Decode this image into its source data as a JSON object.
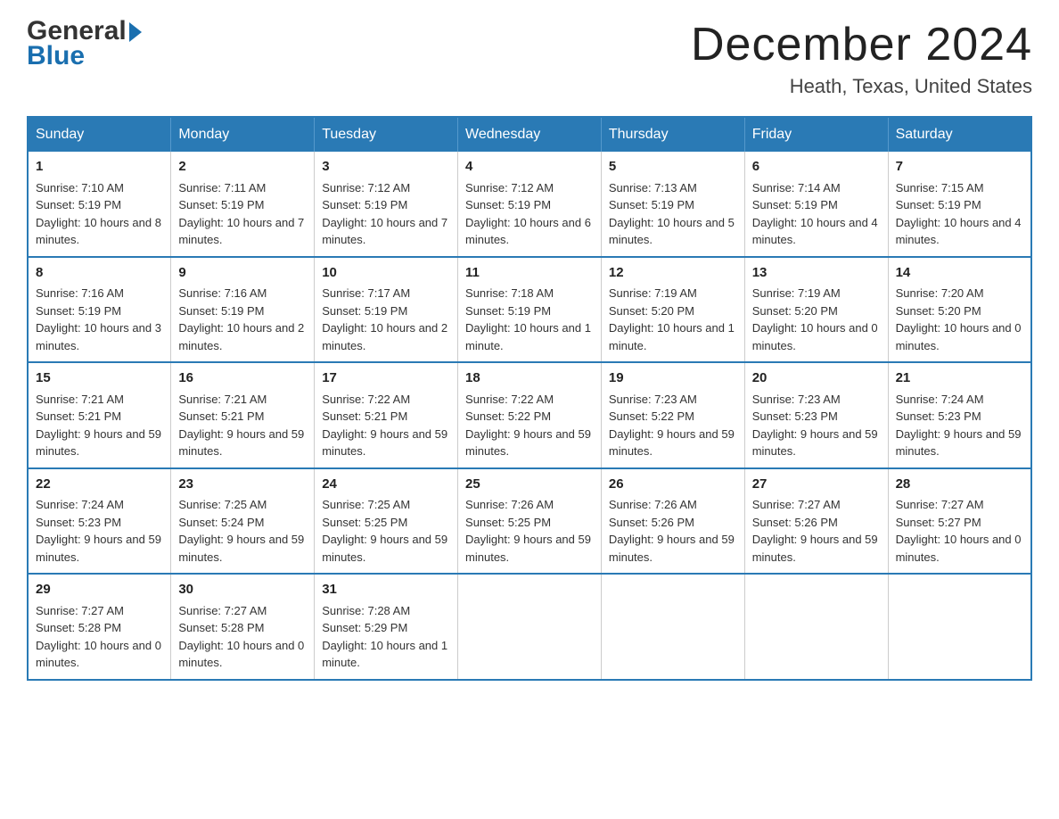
{
  "logo": {
    "name_part1": "General",
    "arrow": "▶",
    "name_part2": "Blue"
  },
  "header": {
    "month_year": "December 2024",
    "location": "Heath, Texas, United States"
  },
  "days_of_week": [
    "Sunday",
    "Monday",
    "Tuesday",
    "Wednesday",
    "Thursday",
    "Friday",
    "Saturday"
  ],
  "weeks": [
    [
      {
        "day": "1",
        "sunrise": "7:10 AM",
        "sunset": "5:19 PM",
        "daylight": "10 hours and 8 minutes."
      },
      {
        "day": "2",
        "sunrise": "7:11 AM",
        "sunset": "5:19 PM",
        "daylight": "10 hours and 7 minutes."
      },
      {
        "day": "3",
        "sunrise": "7:12 AM",
        "sunset": "5:19 PM",
        "daylight": "10 hours and 7 minutes."
      },
      {
        "day": "4",
        "sunrise": "7:12 AM",
        "sunset": "5:19 PM",
        "daylight": "10 hours and 6 minutes."
      },
      {
        "day": "5",
        "sunrise": "7:13 AM",
        "sunset": "5:19 PM",
        "daylight": "10 hours and 5 minutes."
      },
      {
        "day": "6",
        "sunrise": "7:14 AM",
        "sunset": "5:19 PM",
        "daylight": "10 hours and 4 minutes."
      },
      {
        "day": "7",
        "sunrise": "7:15 AM",
        "sunset": "5:19 PM",
        "daylight": "10 hours and 4 minutes."
      }
    ],
    [
      {
        "day": "8",
        "sunrise": "7:16 AM",
        "sunset": "5:19 PM",
        "daylight": "10 hours and 3 minutes."
      },
      {
        "day": "9",
        "sunrise": "7:16 AM",
        "sunset": "5:19 PM",
        "daylight": "10 hours and 2 minutes."
      },
      {
        "day": "10",
        "sunrise": "7:17 AM",
        "sunset": "5:19 PM",
        "daylight": "10 hours and 2 minutes."
      },
      {
        "day": "11",
        "sunrise": "7:18 AM",
        "sunset": "5:19 PM",
        "daylight": "10 hours and 1 minute."
      },
      {
        "day": "12",
        "sunrise": "7:19 AM",
        "sunset": "5:20 PM",
        "daylight": "10 hours and 1 minute."
      },
      {
        "day": "13",
        "sunrise": "7:19 AM",
        "sunset": "5:20 PM",
        "daylight": "10 hours and 0 minutes."
      },
      {
        "day": "14",
        "sunrise": "7:20 AM",
        "sunset": "5:20 PM",
        "daylight": "10 hours and 0 minutes."
      }
    ],
    [
      {
        "day": "15",
        "sunrise": "7:21 AM",
        "sunset": "5:21 PM",
        "daylight": "9 hours and 59 minutes."
      },
      {
        "day": "16",
        "sunrise": "7:21 AM",
        "sunset": "5:21 PM",
        "daylight": "9 hours and 59 minutes."
      },
      {
        "day": "17",
        "sunrise": "7:22 AM",
        "sunset": "5:21 PM",
        "daylight": "9 hours and 59 minutes."
      },
      {
        "day": "18",
        "sunrise": "7:22 AM",
        "sunset": "5:22 PM",
        "daylight": "9 hours and 59 minutes."
      },
      {
        "day": "19",
        "sunrise": "7:23 AM",
        "sunset": "5:22 PM",
        "daylight": "9 hours and 59 minutes."
      },
      {
        "day": "20",
        "sunrise": "7:23 AM",
        "sunset": "5:23 PM",
        "daylight": "9 hours and 59 minutes."
      },
      {
        "day": "21",
        "sunrise": "7:24 AM",
        "sunset": "5:23 PM",
        "daylight": "9 hours and 59 minutes."
      }
    ],
    [
      {
        "day": "22",
        "sunrise": "7:24 AM",
        "sunset": "5:23 PM",
        "daylight": "9 hours and 59 minutes."
      },
      {
        "day": "23",
        "sunrise": "7:25 AM",
        "sunset": "5:24 PM",
        "daylight": "9 hours and 59 minutes."
      },
      {
        "day": "24",
        "sunrise": "7:25 AM",
        "sunset": "5:25 PM",
        "daylight": "9 hours and 59 minutes."
      },
      {
        "day": "25",
        "sunrise": "7:26 AM",
        "sunset": "5:25 PM",
        "daylight": "9 hours and 59 minutes."
      },
      {
        "day": "26",
        "sunrise": "7:26 AM",
        "sunset": "5:26 PM",
        "daylight": "9 hours and 59 minutes."
      },
      {
        "day": "27",
        "sunrise": "7:27 AM",
        "sunset": "5:26 PM",
        "daylight": "9 hours and 59 minutes."
      },
      {
        "day": "28",
        "sunrise": "7:27 AM",
        "sunset": "5:27 PM",
        "daylight": "10 hours and 0 minutes."
      }
    ],
    [
      {
        "day": "29",
        "sunrise": "7:27 AM",
        "sunset": "5:28 PM",
        "daylight": "10 hours and 0 minutes."
      },
      {
        "day": "30",
        "sunrise": "7:27 AM",
        "sunset": "5:28 PM",
        "daylight": "10 hours and 0 minutes."
      },
      {
        "day": "31",
        "sunrise": "7:28 AM",
        "sunset": "5:29 PM",
        "daylight": "10 hours and 1 minute."
      },
      null,
      null,
      null,
      null
    ]
  ],
  "labels": {
    "sunrise": "Sunrise:",
    "sunset": "Sunset:",
    "daylight": "Daylight:"
  }
}
